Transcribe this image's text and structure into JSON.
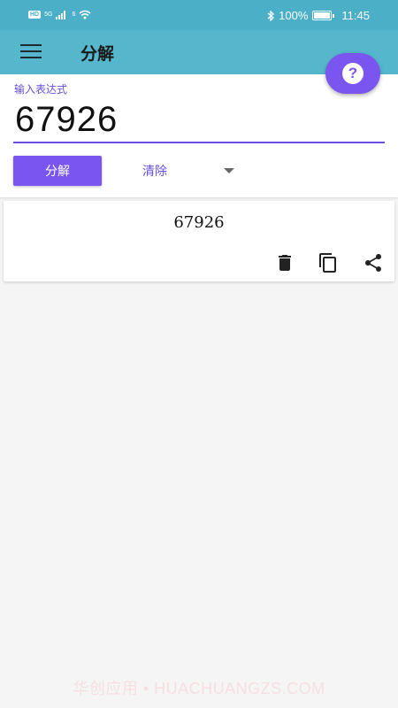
{
  "status_bar": {
    "network_badge": "HD",
    "network_type": "5G",
    "wifi_badge": "6",
    "battery_percent": "100%",
    "time": "11:45"
  },
  "app_bar": {
    "title": "分解"
  },
  "input": {
    "label": "输入表达式",
    "value": "67926"
  },
  "actions": {
    "factor_label": "分解",
    "clear_label": "清除"
  },
  "result": {
    "text": "67926"
  },
  "watermark": "华创应用 • HUACHUANGZS.COM",
  "colors": {
    "primary": "#7a55f0",
    "app_bar": "#56b6cc",
    "status_bar": "#4aafc7"
  }
}
